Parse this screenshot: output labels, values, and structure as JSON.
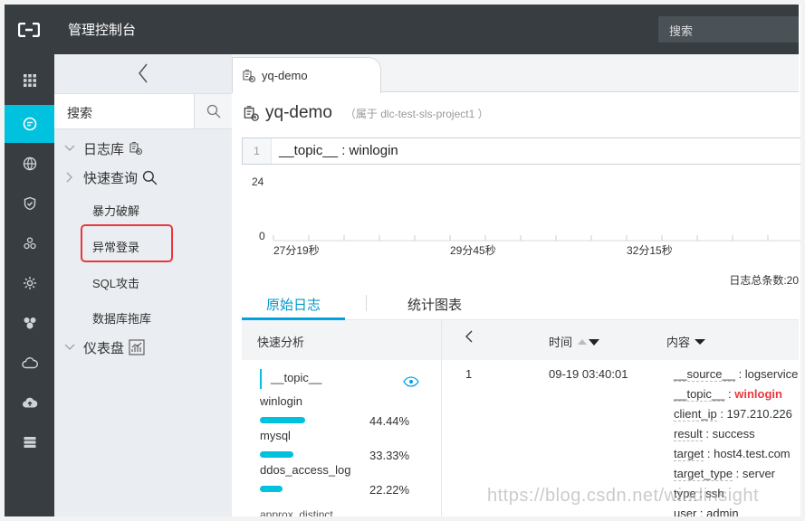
{
  "topbar": {
    "title": "管理控制台",
    "search_placeholder": "搜索"
  },
  "rail": {
    "icons": [
      "grid-icon",
      "log-service-icon",
      "globe-icon",
      "shield-icon",
      "nodes-icon",
      "gear-icon",
      "cluster-icon",
      "cloud-icon",
      "cloud-upload-icon",
      "server-icon"
    ],
    "active_index": 1,
    "accent": "#00c1de"
  },
  "sidebar": {
    "search_label": "搜索",
    "tree": [
      {
        "label": "日志库",
        "expanded": true
      },
      {
        "label": "快速查询",
        "expanded": true
      },
      {
        "label": "仪表盘",
        "expanded": true
      }
    ],
    "quick_queries": [
      "暴力破解",
      "异常登录",
      "SQL攻击",
      "数据库拖库"
    ]
  },
  "tab": {
    "label": "yq-demo"
  },
  "logstore": {
    "name": "yq-demo",
    "project_note": "（属于 dlc-test-sls-project1 ）"
  },
  "query": {
    "line_number": "1",
    "text": "__topic__ : winlogin"
  },
  "chart_data": {
    "type": "bar",
    "y_ticks": [
      "24",
      "0"
    ],
    "ylim": [
      0,
      24
    ],
    "x_ticks": [
      "27分19秒",
      "29分45秒",
      "32分15秒"
    ],
    "values": []
  },
  "log_count_label": "日志总条数:20",
  "result_tabs": {
    "raw": "原始日志",
    "stats": "统计图表"
  },
  "quick_analysis": {
    "header": "快速分析",
    "field": "__topic__",
    "values": [
      {
        "label": "winlogin",
        "percent": "44.44%",
        "fraction": 0.4444
      },
      {
        "label": "mysql",
        "percent": "33.33%",
        "fraction": 0.3333
      },
      {
        "label": "ddos_access_log",
        "percent": "22.22%",
        "fraction": 0.2222
      }
    ],
    "cut_text": "approx_distinct"
  },
  "log_table": {
    "headers": {
      "nav": "<",
      "time": "时间",
      "content": "内容"
    },
    "row": {
      "index": "1",
      "time": "09-19 03:40:01",
      "fields": [
        {
          "key": "__source__",
          "value": "logservice"
        },
        {
          "key": "__topic__",
          "value": "winlogin",
          "highlight": true
        },
        {
          "key": "client_ip",
          "value": "197.210.226"
        },
        {
          "key": "result",
          "value": "success"
        },
        {
          "key": "target",
          "value": "host4.test.com"
        },
        {
          "key": "target_type",
          "value": "server"
        },
        {
          "key": "type",
          "value": "ssh"
        },
        {
          "key": "user",
          "value": "admin"
        }
      ]
    }
  },
  "watermark": "https://blog.csdn.net/windinsight"
}
